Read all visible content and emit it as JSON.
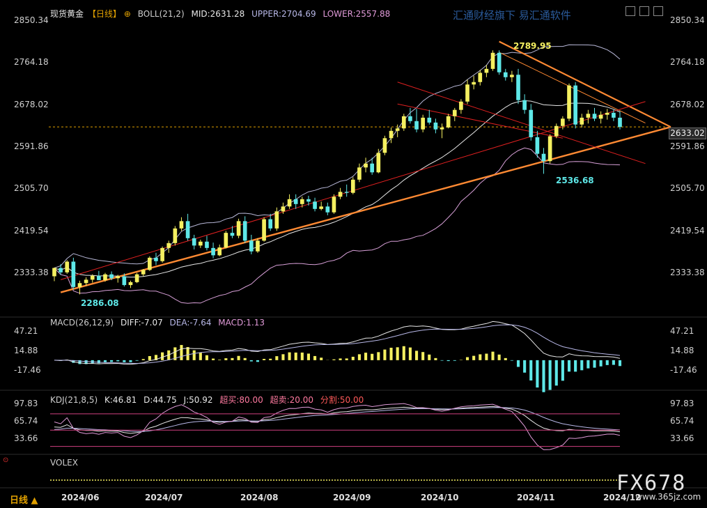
{
  "header": {
    "symbol": "现货黄金",
    "period_tag": "【日线】",
    "indicator": "BOLL(21,2)",
    "mid": "MID:2631.28",
    "upper": "UPPER:2704.69",
    "lower": "LOWER:2557.88",
    "watermark": "汇通财经旗下 易汇通软件"
  },
  "price_axis": {
    "ticks": [
      "2850.34",
      "2764.18",
      "2678.02",
      "2591.86",
      "2505.70",
      "2419.54",
      "2333.38"
    ],
    "last_price": "2633.02"
  },
  "annotations": {
    "high": "2789.95",
    "low_mid": "2536.68",
    "low_start": "2286.08"
  },
  "macd": {
    "title": "MACD(26,12,9)",
    "diff": "DIFF:-7.07",
    "dea": "DEA:-7.64",
    "value": "MACD:1.13",
    "ticks": [
      "47.21",
      "14.88",
      "-17.46"
    ]
  },
  "kdj": {
    "title": "KDJ(21,8,5)",
    "k": "K:46.81",
    "d": "D:44.75",
    "j": "J:50.92",
    "overbought": "超买:80.00",
    "oversold": "超卖:20.00",
    "divide": "分割:50.00",
    "ticks": [
      "97.83",
      "65.74",
      "33.66"
    ]
  },
  "volume": {
    "title": "VOLEX"
  },
  "x_axis": {
    "labels": [
      "2024/06",
      "2024/07",
      "2024/08",
      "2024/09",
      "2024/10",
      "2024/11",
      "2024/12"
    ]
  },
  "footer": {
    "period": "日线",
    "brand": "FX678",
    "site": "www.365jz.com"
  },
  "colors": {
    "up": "#f5f060",
    "down": "#5ee8e8",
    "boll": "#b8b8d8",
    "trend": "#ff8a33",
    "channel": "#e02020"
  },
  "chart_data": {
    "type": "candlestick",
    "title": "现货黄金 日线",
    "ylim": [
      2290,
      2850
    ],
    "x_labels": [
      "2024/06",
      "2024/07",
      "2024/08",
      "2024/09",
      "2024/10",
      "2024/11",
      "2024/12"
    ],
    "candles": [
      [
        2327,
        2345,
        2317,
        2344
      ],
      [
        2344,
        2352,
        2330,
        2335
      ],
      [
        2335,
        2360,
        2332,
        2357
      ],
      [
        2357,
        2365,
        2300,
        2305
      ],
      [
        2305,
        2318,
        2290,
        2313
      ],
      [
        2313,
        2325,
        2307,
        2320
      ],
      [
        2320,
        2331,
        2314,
        2328
      ],
      [
        2328,
        2338,
        2321,
        2319
      ],
      [
        2319,
        2334,
        2316,
        2331
      ],
      [
        2331,
        2337,
        2319,
        2323
      ],
      [
        2323,
        2330,
        2314,
        2327
      ],
      [
        2327,
        2333,
        2306,
        2309
      ],
      [
        2309,
        2318,
        2303,
        2315
      ],
      [
        2315,
        2334,
        2313,
        2331
      ],
      [
        2331,
        2342,
        2327,
        2340
      ],
      [
        2340,
        2368,
        2338,
        2365
      ],
      [
        2365,
        2375,
        2350,
        2358
      ],
      [
        2358,
        2388,
        2355,
        2385
      ],
      [
        2385,
        2400,
        2375,
        2395
      ],
      [
        2395,
        2430,
        2390,
        2425
      ],
      [
        2425,
        2448,
        2420,
        2440
      ],
      [
        2440,
        2455,
        2400,
        2405
      ],
      [
        2405,
        2412,
        2382,
        2390
      ],
      [
        2390,
        2402,
        2385,
        2398
      ],
      [
        2398,
        2410,
        2380,
        2385
      ],
      [
        2385,
        2396,
        2364,
        2370
      ],
      [
        2370,
        2392,
        2368,
        2386
      ],
      [
        2386,
        2420,
        2384,
        2416
      ],
      [
        2416,
        2430,
        2405,
        2410
      ],
      [
        2410,
        2445,
        2405,
        2440
      ],
      [
        2440,
        2450,
        2395,
        2400
      ],
      [
        2400,
        2412,
        2372,
        2378
      ],
      [
        2378,
        2405,
        2375,
        2400
      ],
      [
        2400,
        2448,
        2398,
        2444
      ],
      [
        2444,
        2455,
        2420,
        2425
      ],
      [
        2425,
        2468,
        2420,
        2460
      ],
      [
        2460,
        2478,
        2455,
        2470
      ],
      [
        2470,
        2495,
        2465,
        2485
      ],
      [
        2485,
        2495,
        2465,
        2475
      ],
      [
        2475,
        2490,
        2468,
        2485
      ],
      [
        2485,
        2492,
        2472,
        2480
      ],
      [
        2480,
        2488,
        2460,
        2465
      ],
      [
        2465,
        2480,
        2462,
        2470
      ],
      [
        2470,
        2478,
        2452,
        2458
      ],
      [
        2458,
        2495,
        2455,
        2490
      ],
      [
        2490,
        2508,
        2485,
        2500
      ],
      [
        2500,
        2515,
        2490,
        2498
      ],
      [
        2498,
        2530,
        2495,
        2525
      ],
      [
        2525,
        2558,
        2520,
        2550
      ],
      [
        2550,
        2570,
        2540,
        2558
      ],
      [
        2558,
        2570,
        2535,
        2540
      ],
      [
        2540,
        2588,
        2538,
        2580
      ],
      [
        2580,
        2615,
        2575,
        2610
      ],
      [
        2610,
        2632,
        2600,
        2625
      ],
      [
        2625,
        2638,
        2612,
        2630
      ],
      [
        2630,
        2660,
        2625,
        2655
      ],
      [
        2655,
        2672,
        2640,
        2645
      ],
      [
        2645,
        2670,
        2622,
        2628
      ],
      [
        2628,
        2658,
        2622,
        2652
      ],
      [
        2652,
        2668,
        2638,
        2642
      ],
      [
        2642,
        2650,
        2620,
        2628
      ],
      [
        2628,
        2640,
        2610,
        2632
      ],
      [
        2632,
        2660,
        2630,
        2655
      ],
      [
        2655,
        2672,
        2645,
        2668
      ],
      [
        2668,
        2690,
        2660,
        2685
      ],
      [
        2685,
        2730,
        2680,
        2720
      ],
      [
        2720,
        2738,
        2710,
        2725
      ],
      [
        2725,
        2750,
        2718,
        2744
      ],
      [
        2744,
        2760,
        2735,
        2752
      ],
      [
        2752,
        2790,
        2748,
        2785
      ],
      [
        2785,
        2790,
        2740,
        2745
      ],
      [
        2745,
        2752,
        2728,
        2735
      ],
      [
        2735,
        2748,
        2725,
        2740
      ],
      [
        2740,
        2752,
        2680,
        2688
      ],
      [
        2688,
        2700,
        2660,
        2668
      ],
      [
        2668,
        2680,
        2605,
        2612
      ],
      [
        2612,
        2625,
        2570,
        2578
      ],
      [
        2578,
        2590,
        2537,
        2563
      ],
      [
        2563,
        2618,
        2558,
        2614
      ],
      [
        2614,
        2640,
        2610,
        2635
      ],
      [
        2635,
        2655,
        2628,
        2650
      ],
      [
        2650,
        2722,
        2645,
        2718
      ],
      [
        2718,
        2725,
        2630,
        2638
      ],
      [
        2638,
        2660,
        2632,
        2652
      ],
      [
        2652,
        2668,
        2640,
        2660
      ],
      [
        2660,
        2672,
        2645,
        2650
      ],
      [
        2650,
        2665,
        2640,
        2658
      ],
      [
        2658,
        2670,
        2648,
        2662
      ],
      [
        2662,
        2668,
        2645,
        2652
      ],
      [
        2652,
        2665,
        2628,
        2633
      ]
    ]
  }
}
